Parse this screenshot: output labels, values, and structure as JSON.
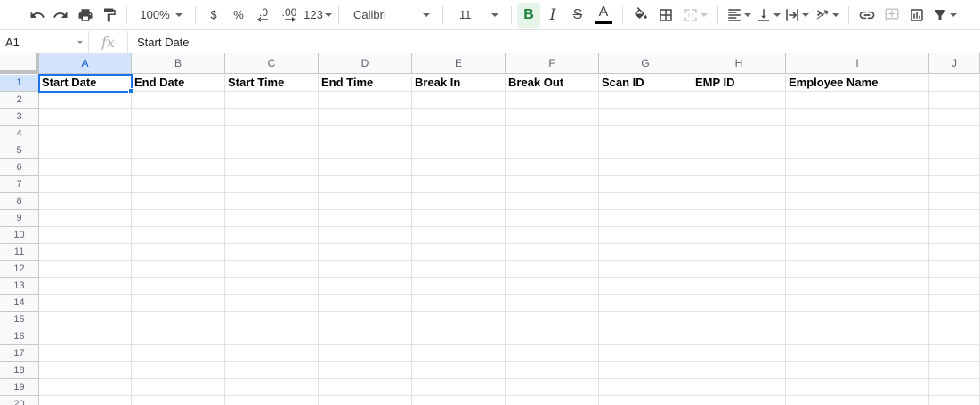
{
  "toolbar": {
    "zoom": "100%",
    "currency": "$",
    "percent": "%",
    "decrease_decimal": ".0",
    "increase_decimal": ".00",
    "more_formats": "123",
    "font_family": "Calibri",
    "font_size": "11",
    "bold": "B",
    "italic": "I",
    "strikethrough": "S",
    "text_color": "A",
    "accent_color": "#188038",
    "text_color_bar": "#000000"
  },
  "formula_bar": {
    "name_box": "A1",
    "fx": "fx",
    "value": "Start Date"
  },
  "sheet": {
    "columns": [
      "A",
      "B",
      "C",
      "D",
      "E",
      "F",
      "G",
      "H",
      "I",
      "J"
    ],
    "rows": [
      "1",
      "2",
      "3",
      "4",
      "5",
      "6",
      "7",
      "8",
      "9",
      "10",
      "11",
      "12",
      "13",
      "14",
      "15",
      "16",
      "17",
      "18",
      "19",
      "20"
    ],
    "headers": [
      "Start Date",
      "End Date",
      "Start Time",
      "End Time",
      "Break In",
      "Break Out",
      "Scan ID",
      "EMP ID",
      "Employee Name",
      ""
    ],
    "selected_cell": "A1",
    "selection_color": "#1a73e8"
  }
}
